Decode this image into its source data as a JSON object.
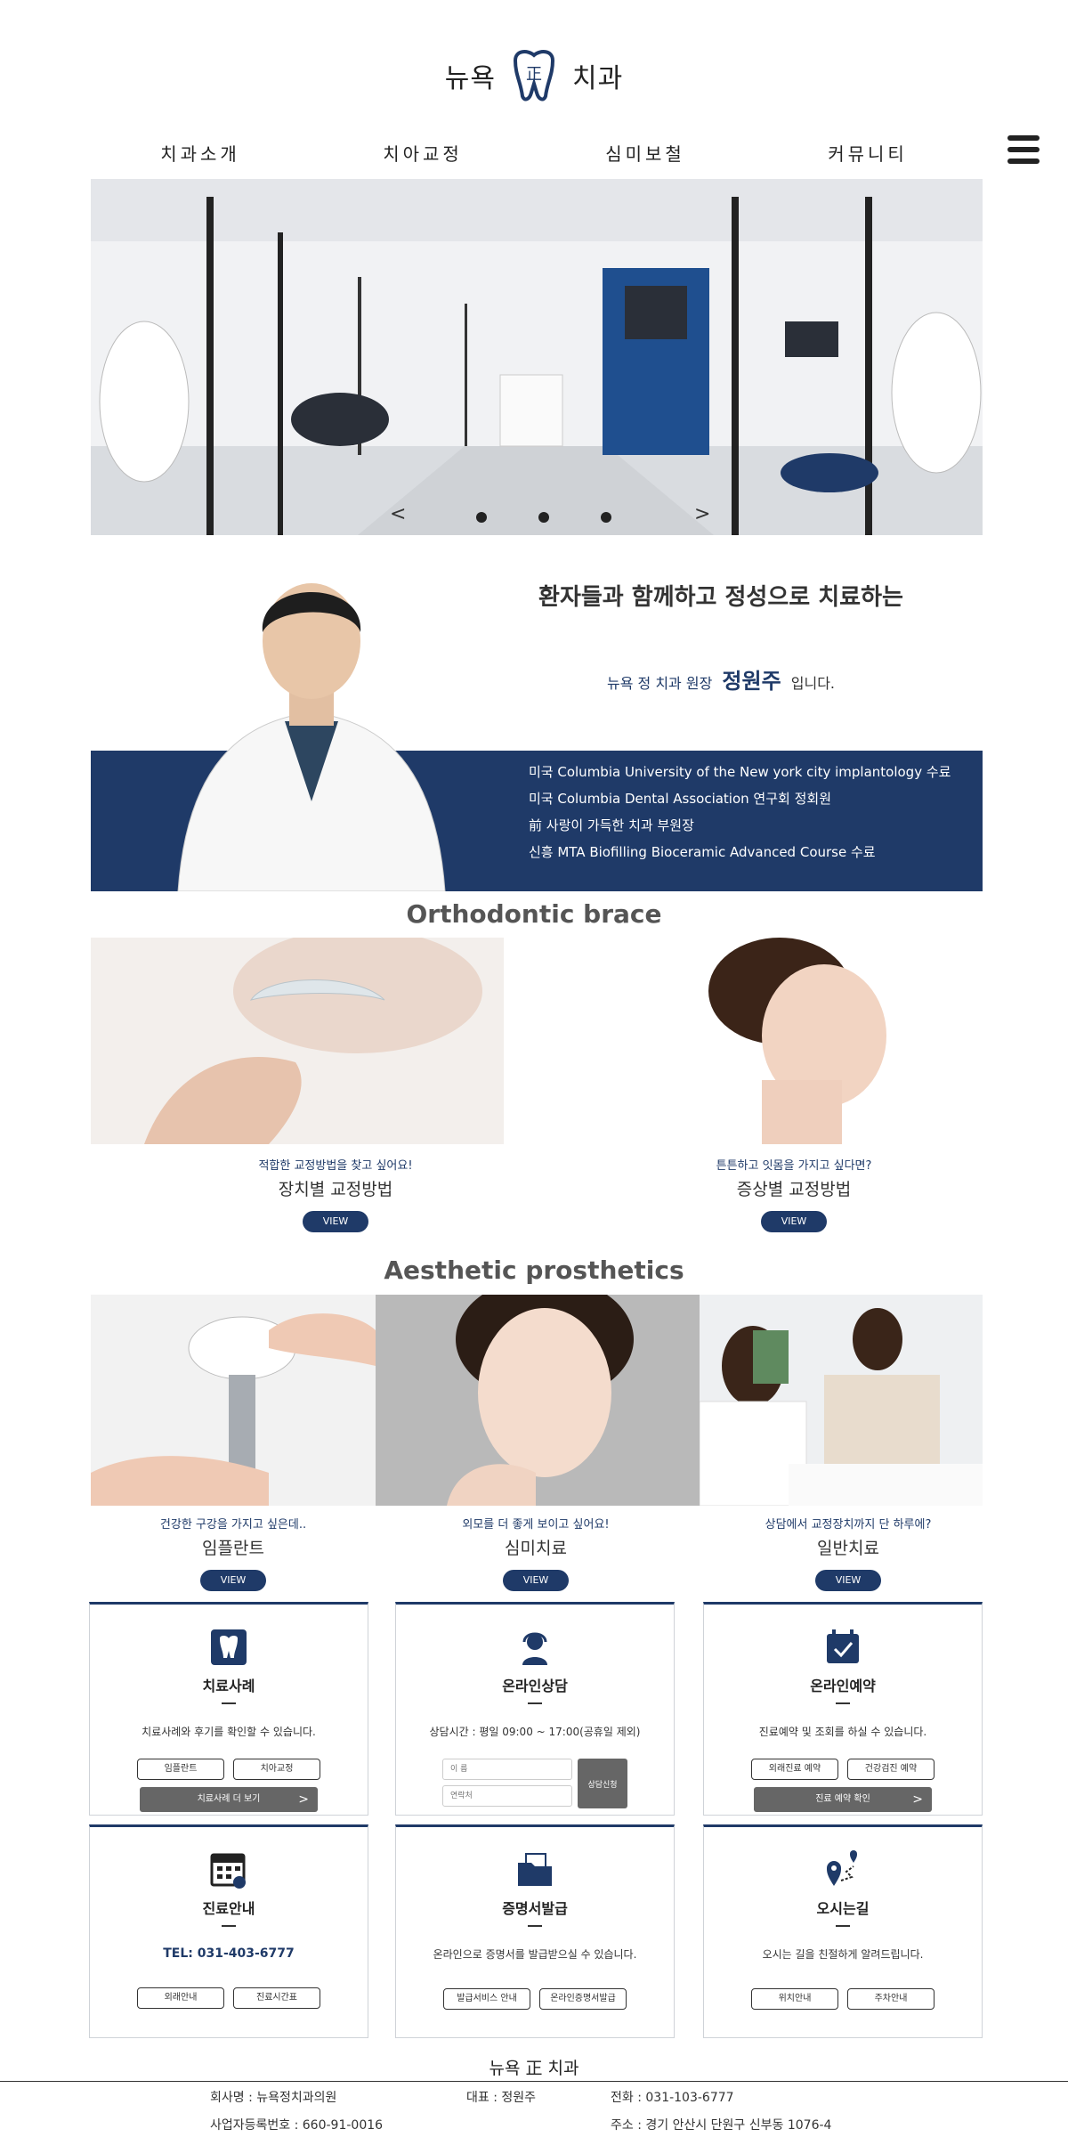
{
  "header": {
    "logo_left": "뉴욕",
    "logo_mark_char": "正",
    "logo_right": "치과",
    "menu_icon": "hamburger-menu-icon"
  },
  "nav": {
    "items": [
      "치과소개",
      "치아교정",
      "심미보철",
      "커뮤니티"
    ]
  },
  "hero": {
    "prev": "<",
    "next": ">",
    "slide_count": 3
  },
  "doctor": {
    "headline": "환자들과 함께하고 정성으로 치료하는",
    "intro_clinic": "뉴욕 정 치과  원장",
    "intro_name": "정원주",
    "intro_tail": "입니다.",
    "career": [
      "미국 Columbia University of the New york city implantology 수료",
      "미국 Columbia Dental Association 연구회 정회원",
      "前 사랑이 가득한 치과 부원장",
      "신흥 MTA Biofilling Bioceramic Advanced Course 수료"
    ]
  },
  "ortho": {
    "title": "Orthodontic brace",
    "cards": [
      {
        "sub": "적합한 교정방법을 찾고 싶어요!",
        "title": "장치별 교정방법",
        "button": "VIEW"
      },
      {
        "sub": "튼튼하고 잇몸을 가지고 싶다면?",
        "title": "증상별 교정방법",
        "button": "VIEW"
      }
    ]
  },
  "aesthetic": {
    "title": "Aesthetic prosthetics",
    "cards": [
      {
        "sub": "건강한 구강을 가지고 싶은데..",
        "title": "임플란트",
        "button": "VIEW"
      },
      {
        "sub": "외모를 더 좋게 보이고 싶어요!",
        "title": "심미치료",
        "button": "VIEW"
      },
      {
        "sub": "상담에서 교정장치까지 단 하루에?",
        "title": "일반치료",
        "button": "VIEW"
      }
    ]
  },
  "services": {
    "cases": {
      "title": "치료사례",
      "desc": "치료사례와 후기를 확인할 수 있습니다.",
      "buttons": [
        "임플란트",
        "치아교정"
      ],
      "wide": "치료사례 더 보기",
      "arrow": ">"
    },
    "consult": {
      "title": "온라인상담",
      "desc": "상담시간 : 평일 09:00 ~ 17:00(공휴일 제외)",
      "name_placeholder": "이 름",
      "phone_placeholder": "연락처",
      "button": "상담신청"
    },
    "reserve": {
      "title": "온라인예약",
      "desc": "진료예약 및 조회를 하실 수 있습니다.",
      "buttons": [
        "외래진료 예약",
        "건강검진 예약"
      ],
      "wide": "진료 예약 확인",
      "arrow": ">"
    },
    "guide": {
      "title": "진료안내",
      "tel": "TEL: 031-403-6777",
      "buttons": [
        "외래안내",
        "진료시간표"
      ]
    },
    "cert": {
      "title": "증명서발급",
      "desc": "온라인으로 증명서를 발급받으실 수 있습니다.",
      "buttons": [
        "발급서비스 안내",
        "온라인증명서발급"
      ]
    },
    "map": {
      "title": "오시는길",
      "desc": "오시는 길을 친절하게 알려드립니다.",
      "buttons": [
        "위치안내",
        "주차안내"
      ]
    }
  },
  "footer": {
    "name": "뉴욕 正 치과",
    "company": "회사명 : 뉴욕정치과의원",
    "ceo": "대표 : 정원주",
    "phone": "전화 : 031-103-6777",
    "biz_no": "사업자등록번호 : 660-91-0016",
    "address": "주소 : 경기 안산시 단원구 신부동 1076-4"
  },
  "colors": {
    "navy": "#1f3a68",
    "gray_button": "#666666"
  }
}
